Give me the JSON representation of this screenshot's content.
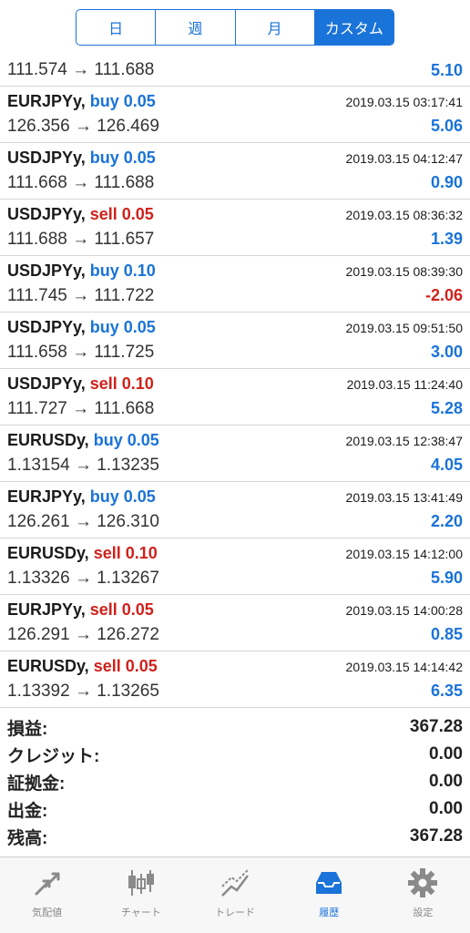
{
  "segments": [
    {
      "label": "日",
      "active": false
    },
    {
      "label": "週",
      "active": false
    },
    {
      "label": "月",
      "active": false
    },
    {
      "label": "カスタム",
      "active": true
    }
  ],
  "partial_row": {
    "prices": "111.574 → 111.688",
    "profit": "5.10"
  },
  "trades": [
    {
      "symbol": "EURJPYy,",
      "side": "buy",
      "lots": "0.05",
      "time": "2019.03.15 03:17:41",
      "prices": "126.356 → 126.469",
      "profit": "5.06",
      "profit_sign": "pos"
    },
    {
      "symbol": "USDJPYy,",
      "side": "buy",
      "lots": "0.05",
      "time": "2019.03.15 04:12:47",
      "prices": "111.668 → 111.688",
      "profit": "0.90",
      "profit_sign": "pos"
    },
    {
      "symbol": "USDJPYy,",
      "side": "sell",
      "lots": "0.05",
      "time": "2019.03.15 08:36:32",
      "prices": "111.688 → 111.657",
      "profit": "1.39",
      "profit_sign": "pos"
    },
    {
      "symbol": "USDJPYy,",
      "side": "buy",
      "lots": "0.10",
      "time": "2019.03.15 08:39:30",
      "prices": "111.745 → 111.722",
      "profit": "-2.06",
      "profit_sign": "neg"
    },
    {
      "symbol": "USDJPYy,",
      "side": "buy",
      "lots": "0.05",
      "time": "2019.03.15 09:51:50",
      "prices": "111.658 → 111.725",
      "profit": "3.00",
      "profit_sign": "pos"
    },
    {
      "symbol": "USDJPYy,",
      "side": "sell",
      "lots": "0.10",
      "time": "2019.03.15 11:24:40",
      "prices": "111.727 → 111.668",
      "profit": "5.28",
      "profit_sign": "pos"
    },
    {
      "symbol": "EURUSDy,",
      "side": "buy",
      "lots": "0.05",
      "time": "2019.03.15 12:38:47",
      "prices": "1.13154 → 1.13235",
      "profit": "4.05",
      "profit_sign": "pos"
    },
    {
      "symbol": "EURJPYy,",
      "side": "buy",
      "lots": "0.05",
      "time": "2019.03.15 13:41:49",
      "prices": "126.261 → 126.310",
      "profit": "2.20",
      "profit_sign": "pos"
    },
    {
      "symbol": "EURUSDy,",
      "side": "sell",
      "lots": "0.10",
      "time": "2019.03.15 14:12:00",
      "prices": "1.13326 → 1.13267",
      "profit": "5.90",
      "profit_sign": "pos"
    },
    {
      "symbol": "EURJPYy,",
      "side": "sell",
      "lots": "0.05",
      "time": "2019.03.15 14:00:28",
      "prices": "126.291 → 126.272",
      "profit": "0.85",
      "profit_sign": "pos"
    },
    {
      "symbol": "EURUSDy,",
      "side": "sell",
      "lots": "0.05",
      "time": "2019.03.15 14:14:42",
      "prices": "1.13392 → 1.13265",
      "profit": "6.35",
      "profit_sign": "pos"
    }
  ],
  "summary": [
    {
      "label": "損益:",
      "value": "367.28"
    },
    {
      "label": "クレジット:",
      "value": "0.00"
    },
    {
      "label": "証拠金:",
      "value": "0.00"
    },
    {
      "label": "出金:",
      "value": "0.00"
    },
    {
      "label": "残高:",
      "value": "367.28"
    }
  ],
  "tabs": [
    {
      "label": "気配値",
      "icon": "quotes-arrows-icon",
      "active": false
    },
    {
      "label": "チャート",
      "icon": "candlestick-chart-icon",
      "active": false
    },
    {
      "label": "トレード",
      "icon": "trade-trend-icon",
      "active": false
    },
    {
      "label": "履歴",
      "icon": "history-tray-icon",
      "active": true
    },
    {
      "label": "設定",
      "icon": "gear-icon",
      "active": false
    }
  ],
  "colors": {
    "accent": "#1a73d9",
    "sell": "#d0211b",
    "inactive": "#8a8a8a"
  }
}
